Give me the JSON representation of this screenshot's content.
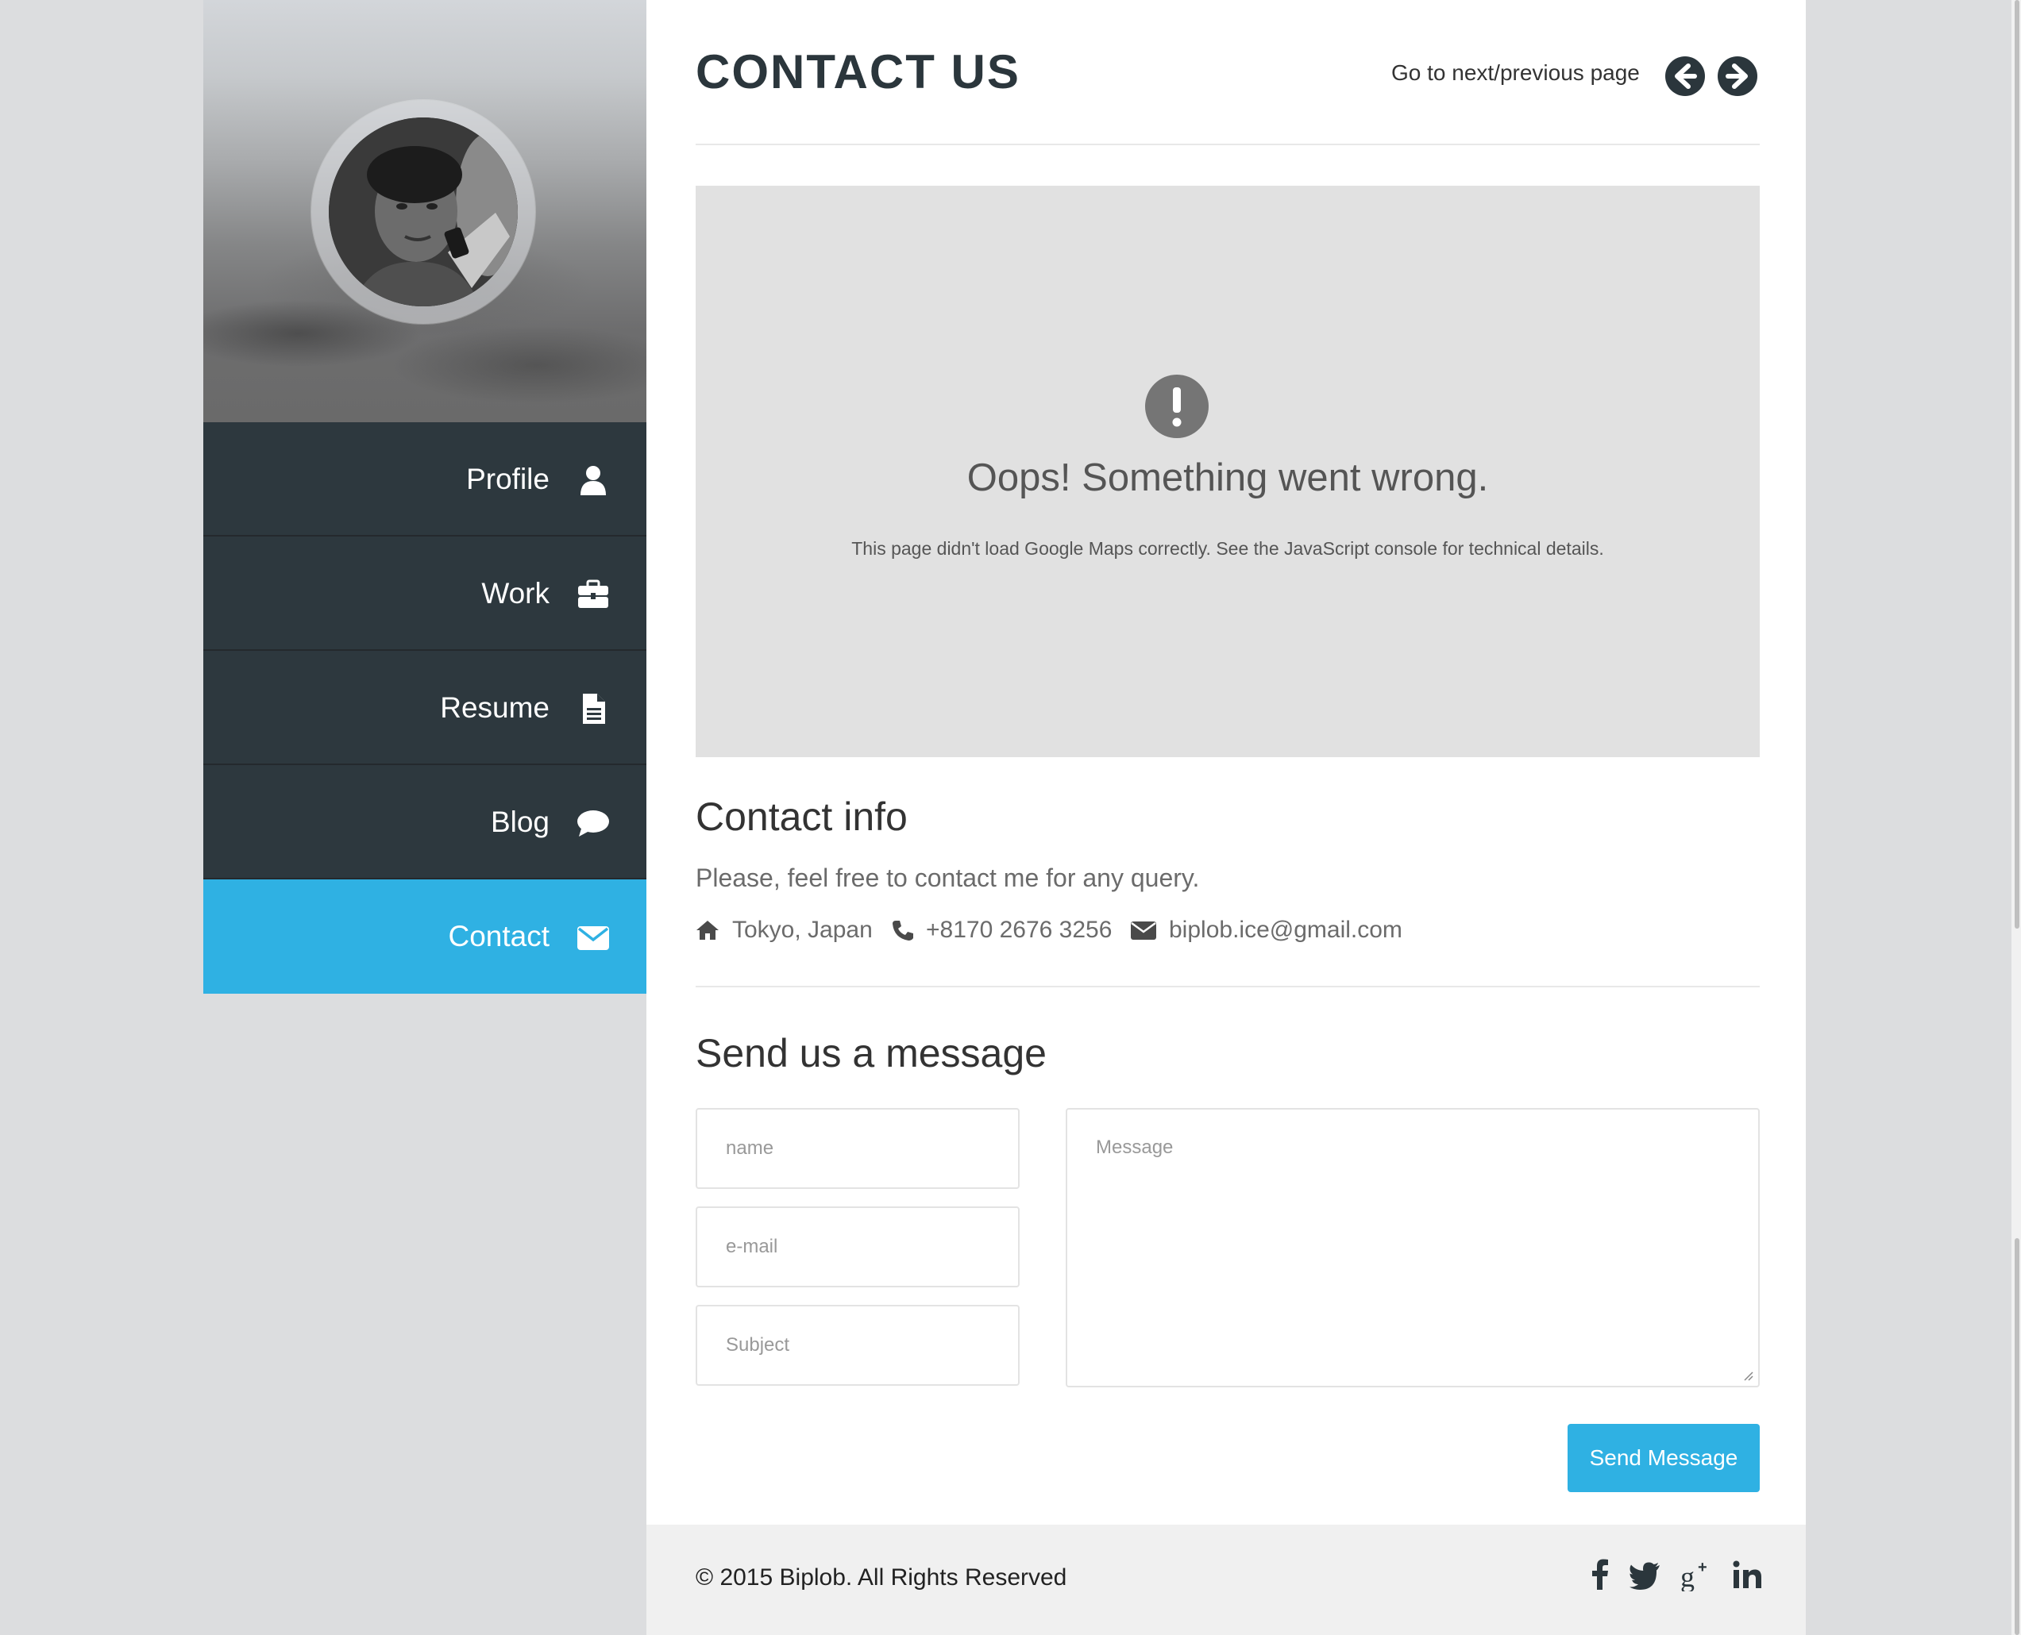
{
  "sidebar": {
    "items": [
      {
        "label": "Profile",
        "icon": "user-icon"
      },
      {
        "label": "Work",
        "icon": "briefcase-icon"
      },
      {
        "label": "Resume",
        "icon": "document-icon"
      },
      {
        "label": "Blog",
        "icon": "comment-icon"
      },
      {
        "label": "Contact",
        "icon": "envelope-icon",
        "active": true
      }
    ],
    "active_color": "#2fb1e3",
    "item_color": "#2d383e"
  },
  "header": {
    "title": "CONTACT US",
    "nav_hint": "Go to next/previous page",
    "prev_icon": "arrow-left-circle-icon",
    "next_icon": "arrow-right-circle-icon"
  },
  "map": {
    "error_title": "Oops! Something went wrong.",
    "error_detail": "This page didn't load Google Maps correctly. See the JavaScript console for technical details.",
    "icon": "exclamation-circle-icon"
  },
  "contact_info": {
    "heading": "Contact info",
    "intro": "Please, feel free to contact me for any query.",
    "location": "Tokyo, Japan",
    "phone": "+8170 2676 3256",
    "email": "biplob.ice@gmail.com"
  },
  "message_form": {
    "heading": "Send us a message",
    "name_placeholder": "name",
    "email_placeholder": "e-mail",
    "subject_placeholder": "Subject",
    "message_placeholder": "Message",
    "send_label": "Send Message"
  },
  "footer": {
    "copyright": "© 2015 Biplob. All Rights Reserved",
    "social": [
      "facebook-icon",
      "twitter-icon",
      "google-plus-icon",
      "linkedin-icon"
    ]
  }
}
